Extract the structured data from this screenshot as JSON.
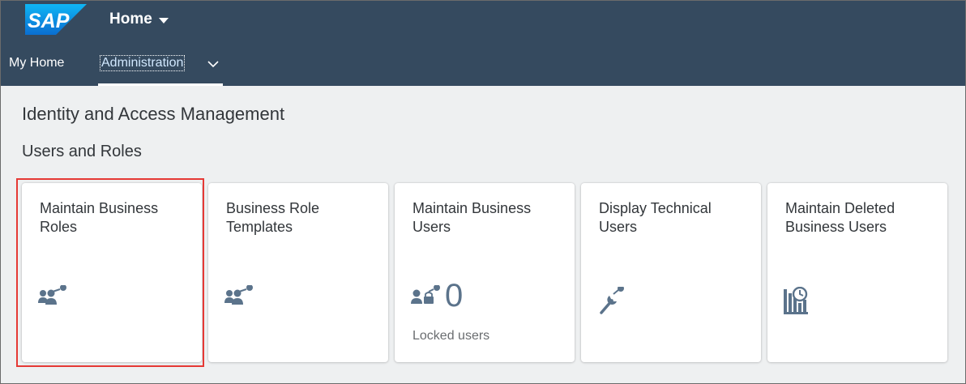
{
  "header": {
    "logo_text": "SAP",
    "home_title": "Home"
  },
  "tabs": [
    {
      "label": "My Home"
    },
    {
      "label": "Administration",
      "selected": true
    }
  ],
  "section_title": "Identity and Access Management",
  "group_title": "Users and Roles",
  "tiles": [
    {
      "title": "Maintain Business Roles",
      "icon": "business-role-key-icon"
    },
    {
      "title": "Business Role Templates",
      "icon": "business-role-key-icon"
    },
    {
      "title": "Maintain Business Users",
      "icon": "locked-users-icon",
      "kpi": "0",
      "footer": "Locked users"
    },
    {
      "title": "Display Technical Users",
      "icon": "wrench-key-icon"
    },
    {
      "title": "Maintain Deleted Business Users",
      "icon": "deleted-users-history-icon"
    }
  ],
  "colors": {
    "shell_bg": "#354a5f",
    "icon": "#5b738b",
    "highlight": "#e53935",
    "logo_blue": "#0a8ae0"
  }
}
